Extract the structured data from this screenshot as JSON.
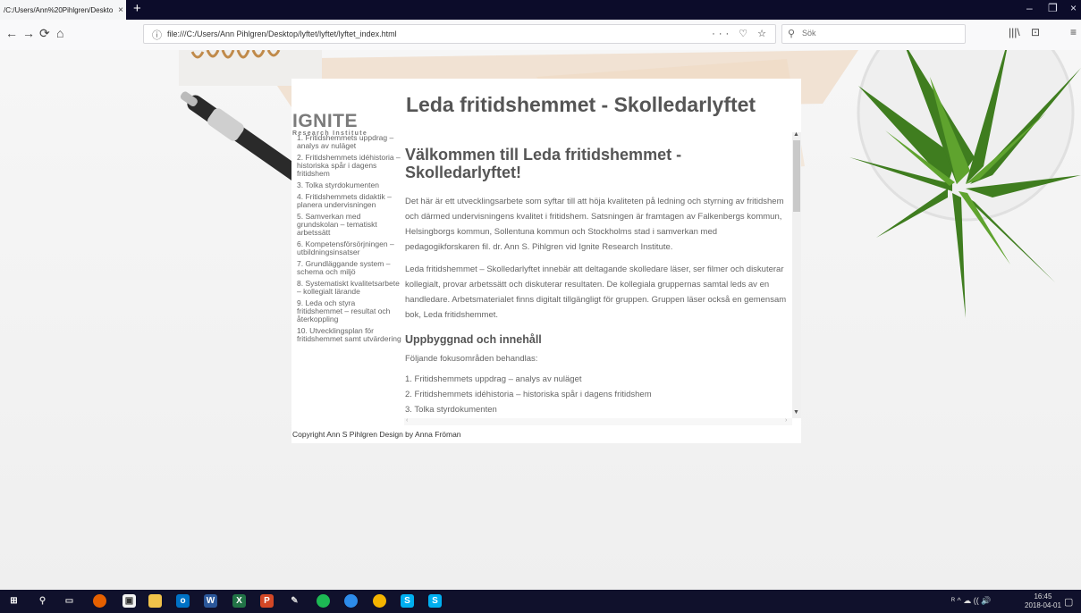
{
  "browser": {
    "tab_title": "/C:/Users/Ann%20Pihlgren/Deskto",
    "tab_close": "×",
    "new_tab": "+",
    "window_controls": [
      "–",
      "❐",
      "×"
    ],
    "back": "←",
    "forward": "→",
    "reload": "⟳",
    "home": "⌂",
    "url": "file:///C:/Users/Ann Pihlgren/Desktop/lyftet/lyftet/lyftet_index.html",
    "url_actions": "··· ♡ ☆",
    "search_placeholder": "Sök",
    "nav_right": [
      "|||\\",
      "⊡",
      "≡"
    ]
  },
  "site": {
    "logo_word": "IGNITE",
    "logo_sub": "Research Institute",
    "title": "Leda fritidshemmet - Skolledarlyftet",
    "nav": [
      "1. Fritidshemmets uppdrag – analys av nuläget",
      "2. Fritidshemmets idéhistoria – historiska spår i dagens fritidshem",
      "3. Tolka styrdokumenten",
      "4. Fritidshemmets didaktik – planera undervisningen",
      "5. Samverkan med grundskolan – tematiskt arbetssätt",
      "6. Kompetensförsörjningen – utbildningsinsatser",
      "7. Grundläggande system – schema och miljö",
      "8. Systematiskt kvalitetsarbete – kollegialt lärande",
      "9. Leda och styra fritidshemmet – resultat och återkoppling",
      "10. Utvecklingsplan för fritidshemmet samt utvärdering"
    ],
    "main": {
      "heading": "Välkommen till Leda fritidshemmet - Skolledarlyftet!",
      "p1": "Det här är ett utvecklingsarbete som syftar till att höja kvaliteten på ledning och styrning av fritidshem och därmed undervisningens kvalitet i fritidshem. Satsningen är framtagen av Falkenbergs kommun, Helsingborgs kommun, Sollentuna kommun och Stockholms stad i samverkan med pedagogikforskaren fil. dr. Ann S. Pihlgren vid Ignite Research Institute.",
      "p2": "Leda fritidshemmet – Skolledarlyftet innebär att deltagande skolledare läser, ser filmer och diskuterar kollegialt, provar arbetssätt och diskuterar resultaten. De kollegiala gruppernas samtal leds av en handledare. Arbetsmaterialet finns digitalt tillgängligt för gruppen. Gruppen läser också en gemensam bok, Leda fritidshemmet.",
      "subheading": "Uppbyggnad och innehåll",
      "lead": "Följande fokusområden behandlas:",
      "list": [
        "1. Fritidshemmets uppdrag – analys av nuläget",
        "2. Fritidshemmets idéhistoria – historiska spår i dagens fritidshem",
        "3. Tolka styrdokumenten"
      ]
    },
    "copyright": "Copyright Ann S Pihlgren Design by Anna Fröman"
  },
  "taskbar": {
    "clock_time": "16:45",
    "clock_date": "2018-04-01",
    "tray": "ᴿ ^ ☁ (( 🔊"
  },
  "colors": {
    "taskbar": "#10112c",
    "tabbar": "#0c0c2a",
    "logo_green": "#7cb33a"
  }
}
